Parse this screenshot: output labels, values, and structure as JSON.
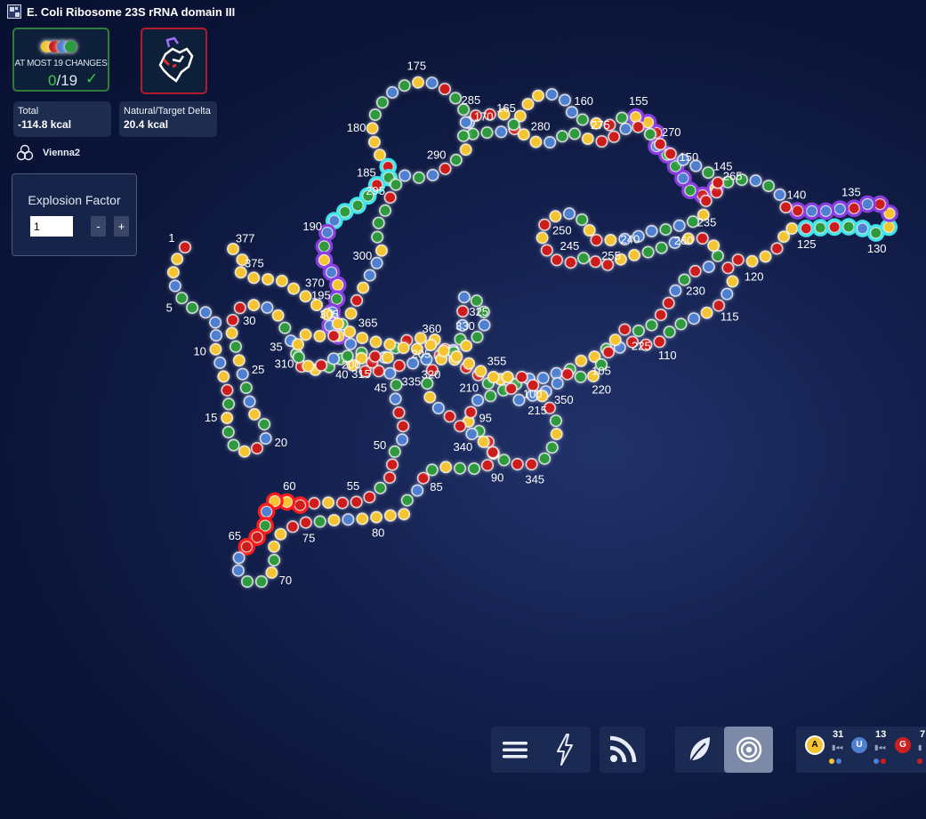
{
  "header": {
    "title": "E. Coli Ribosome 23S rRNA domain III"
  },
  "constraints": {
    "label": "AT MOST 19 CHANGES",
    "current": "0",
    "total": "/19"
  },
  "energy": {
    "total_label": "Total",
    "total_value": "-114.8 kcal",
    "delta_label": "Natural/Target Delta",
    "delta_value": "20.4 kcal"
  },
  "engine": {
    "name": "Vienna2"
  },
  "explosion": {
    "title": "Explosion Factor",
    "value": "1",
    "minus": "-",
    "plus": "+"
  },
  "palette": {
    "a_label": "A",
    "a_count": "31",
    "u_label": "U",
    "u_count": "13",
    "g_label": "G",
    "g_count": "7"
  },
  "colors": {
    "A": "#f4c430",
    "U": "#4f7fd0",
    "G": "#cc1f1f",
    "C": "#2e9a3e",
    "cyan": "#3ee6ec",
    "purple": "#8a3ee0",
    "red": "#ff1a1a"
  },
  "icons": {
    "menu": "menu-icon",
    "lightning": "lightning-icon",
    "rss": "rss-icon",
    "leaf": "leaf-icon",
    "target": "target-icon",
    "engine": "vienna-engine-icon"
  },
  "labels": [
    "1",
    "5",
    "10",
    "15",
    "20",
    "25",
    "30",
    "35",
    "40",
    "45",
    "50",
    "55",
    "60",
    "65",
    "70",
    "75",
    "80",
    "85",
    "90",
    "95",
    "100",
    "105",
    "110",
    "115",
    "120",
    "125",
    "130",
    "135",
    "140",
    "145",
    "150",
    "155",
    "160",
    "165",
    "170",
    "175",
    "180",
    "185",
    "190",
    "195",
    "200",
    "205",
    "210",
    "215",
    "220",
    "225",
    "230",
    "235",
    "240",
    "245",
    "250",
    "255",
    "260",
    "265",
    "270",
    "275",
    "280",
    "285",
    "290",
    "295",
    "300",
    "305",
    "310",
    "315",
    "320",
    "325",
    "330",
    "335",
    "340",
    "345",
    "350",
    "355",
    "360",
    "365",
    "370",
    "375",
    "377"
  ],
  "sequence": "GAAUCCUUUAUAGCACCAGUCAUCUACAGGAUACUCGACCAGGUCUGGUCGGCGGGAGGAAUCGGUUCCACAAGGCAUAAAACUGCACCGAGCAGUCCCUUUCAACUGGGCCUAGUAGGAAGAAGCGCUCAAGUGUUUGGUCUCCAGCUCCUGAACGACUUUAAAGUCCUCCGUACUCCAAAGCGCCCUUCAUACUUAUCGUCGAAGAGGCAGUUUUGCACGAGCCGGUCGUCAGAUCCAAGGCGGGAGAUCAGAUUUCUCAGGGCUUGGCGUGGACCUAACAGGUCACGUCUCGCCCAUUAGACGAAACAGUCAGAGUUGUCUGUCCUCACAGCAUGGUAGCGGCCACGAGG"
}
